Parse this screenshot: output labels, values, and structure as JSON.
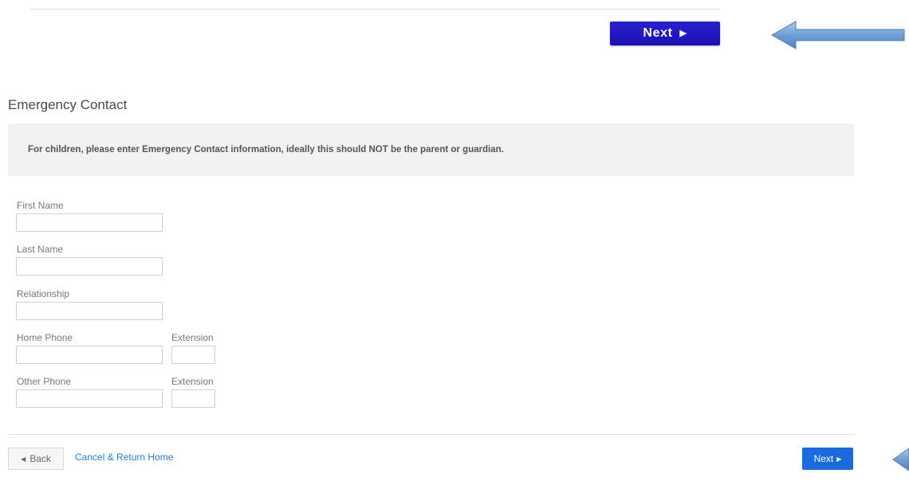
{
  "header": {
    "next_label": "Next",
    "next_icon": "play-triangle-icon"
  },
  "annotation": {
    "arrow_color": "#6f9fd6",
    "arrow_icon": "left-arrow-icon"
  },
  "section": {
    "title": "Emergency Contact",
    "notice": "For children, please enter Emergency Contact information, ideally this should NOT be the parent or guardian."
  },
  "form": {
    "first_name": {
      "label": "First Name",
      "value": "",
      "placeholder": ""
    },
    "last_name": {
      "label": "Last Name",
      "value": "",
      "placeholder": ""
    },
    "relationship": {
      "label": "Relationship",
      "value": "",
      "placeholder": ""
    },
    "home_phone": {
      "label": "Home Phone",
      "value": "",
      "placeholder": ""
    },
    "home_extension": {
      "label": "Extension",
      "value": "",
      "placeholder": ""
    },
    "other_phone": {
      "label": "Other Phone",
      "value": "",
      "placeholder": ""
    },
    "other_extension": {
      "label": "Extension",
      "value": "",
      "placeholder": ""
    }
  },
  "footer": {
    "back_label": "Back",
    "back_icon": "chevron-left-icon",
    "cancel_label": "Cancel & Return Home",
    "next_label": "Next",
    "next_icon": "chevron-right-icon",
    "next_color": "#1b6ae0"
  }
}
